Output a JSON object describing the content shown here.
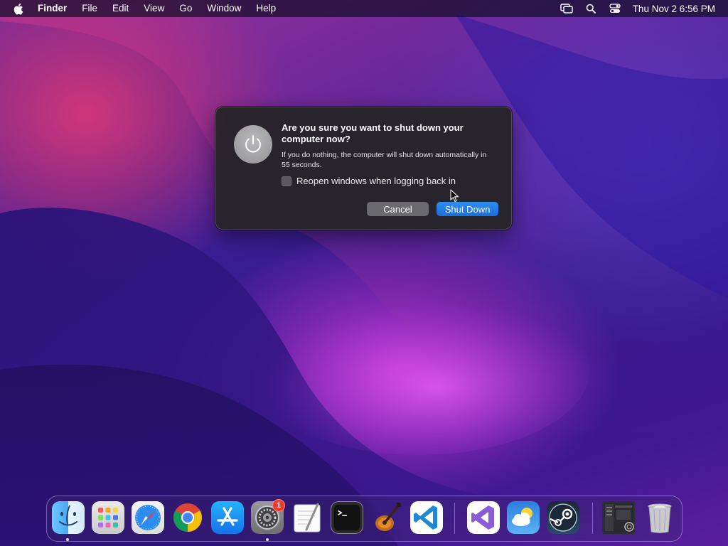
{
  "menubar": {
    "items": [
      "Finder",
      "File",
      "Edit",
      "View",
      "Go",
      "Window",
      "Help"
    ],
    "status_icons": [
      "screen-mirroring-icon",
      "search-icon",
      "control-center-icon"
    ],
    "clock": "Thu Nov 2  6:56 PM"
  },
  "dialog": {
    "title": "Are you sure you want to shut down your computer now?",
    "message": "If you do nothing, the computer will shut down automatically in 55 seconds.",
    "checkbox_label": "Reopen windows when logging back in",
    "checkbox_checked": false,
    "cancel_label": "Cancel",
    "confirm_label": "Shut Down"
  },
  "dock": {
    "apps": [
      "Finder",
      "Launchpad",
      "Safari",
      "Google Chrome",
      "App Store",
      "System Settings",
      "TextEdit",
      "Terminal",
      "GarageBand",
      "Visual Studio Code",
      "Visual Studio",
      "Weather",
      "Steam",
      "Downloads",
      "Trash"
    ],
    "system_settings_badge": "1"
  },
  "colors": {
    "accent": "#1a6fdc",
    "badge": "#f2382e"
  }
}
